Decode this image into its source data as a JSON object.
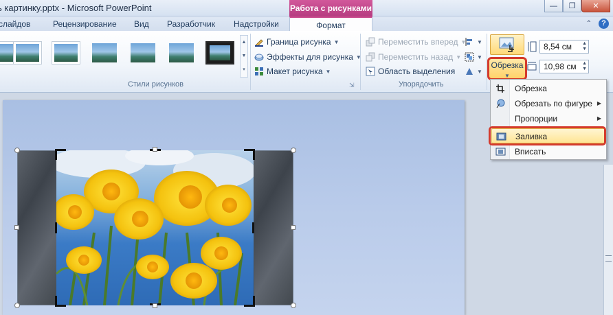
{
  "window": {
    "title": "ь картинку.pptx - Microsoft PowerPoint",
    "context_group": "Работа с рисунками"
  },
  "tabs": [
    {
      "label": "слайдов"
    },
    {
      "label": "Рецензирование"
    },
    {
      "label": "Вид"
    },
    {
      "label": "Разработчик"
    },
    {
      "label": "Надстройки"
    },
    {
      "label": "Формат",
      "active": true
    }
  ],
  "ribbon": {
    "styles_group": {
      "label": "Стили рисунков"
    },
    "picture_border": "Граница рисунка",
    "picture_effects": "Эффекты для рисунка",
    "picture_layout": "Макет рисунка",
    "bring_forward": "Переместить вперед",
    "send_backward": "Переместить назад",
    "selection_pane": "Область выделения",
    "arrange_group": {
      "label": "Упорядочить"
    },
    "crop_button": "Обрезка",
    "height_value": "8,54 см",
    "width_value": "10,98 см"
  },
  "crop_menu": {
    "items": [
      {
        "label": "Обрезка",
        "icon": "crop-icon"
      },
      {
        "label": "Обрезать по фигуре",
        "icon": "shape-crop-icon",
        "submenu": true
      },
      {
        "label": "Пропорции",
        "submenu": true
      },
      {
        "label": "Заливка",
        "icon": "fill-icon",
        "highlighted": true
      },
      {
        "label": "Вписать",
        "icon": "fit-icon"
      }
    ]
  },
  "colors": {
    "context_accent": "#c94a8d",
    "highlight_border": "#d43a2c",
    "menu_hover": "#ffe594"
  }
}
